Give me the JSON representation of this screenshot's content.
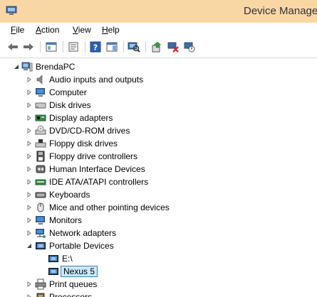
{
  "window": {
    "title": "Device Manage"
  },
  "menu": [
    {
      "pre": "",
      "u": "F",
      "post": "ile"
    },
    {
      "pre": "",
      "u": "A",
      "post": "ction"
    },
    {
      "pre": "",
      "u": "V",
      "post": "iew"
    },
    {
      "pre": "",
      "u": "H",
      "post": "elp"
    }
  ],
  "toolbar": {
    "buttons": [
      "back-arrow-icon",
      "forward-arrow-icon",
      "show-hide-console-tree-icon",
      "properties-icon",
      "help-icon",
      "action-pane-icon",
      "scan-hardware-icon",
      "update-driver-icon",
      "uninstall-icon",
      "disable-device-icon"
    ]
  },
  "tree": {
    "root": "BrendaPC",
    "items": [
      {
        "label": "Audio inputs and outputs",
        "icon": "speaker-icon",
        "expanded": false
      },
      {
        "label": "Computer",
        "icon": "computer-icon",
        "expanded": false
      },
      {
        "label": "Disk drives",
        "icon": "disk-drive-icon",
        "expanded": false
      },
      {
        "label": "Display adapters",
        "icon": "display-adapter-icon",
        "expanded": false
      },
      {
        "label": "DVD/CD-ROM drives",
        "icon": "dvd-drive-icon",
        "expanded": false
      },
      {
        "label": "Floppy disk drives",
        "icon": "floppy-disk-icon",
        "expanded": false
      },
      {
        "label": "Floppy drive controllers",
        "icon": "floppy-controller-icon",
        "expanded": false
      },
      {
        "label": "Human Interface Devices",
        "icon": "hid-icon",
        "expanded": false
      },
      {
        "label": "IDE ATA/ATAPI controllers",
        "icon": "ide-controller-icon",
        "expanded": false
      },
      {
        "label": "Keyboards",
        "icon": "keyboard-icon",
        "expanded": false
      },
      {
        "label": "Mice and other pointing devices",
        "icon": "mouse-icon",
        "expanded": false
      },
      {
        "label": "Monitors",
        "icon": "monitor-icon",
        "expanded": false
      },
      {
        "label": "Network adapters",
        "icon": "network-adapter-icon",
        "expanded": false
      },
      {
        "label": "Portable Devices",
        "icon": "portable-device-icon",
        "expanded": true,
        "children": [
          {
            "label": "E:\\",
            "icon": "portable-device-icon",
            "selected": false
          },
          {
            "label": "Nexus 5",
            "icon": "portable-device-icon",
            "selected": true
          }
        ]
      },
      {
        "label": "Print queues",
        "icon": "printer-icon",
        "expanded": false
      },
      {
        "label": "Processors",
        "icon": "processor-icon",
        "expanded": false
      }
    ]
  }
}
